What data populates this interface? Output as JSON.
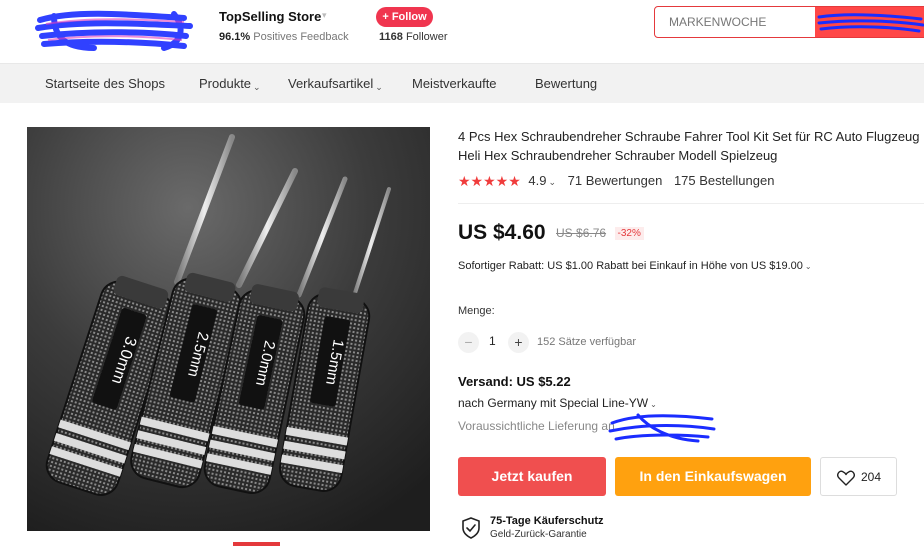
{
  "header": {
    "store_name": "TopSelling Store",
    "feedback_percent": "96.1%",
    "feedback_label": "Positives Feedback",
    "follow_label": "+ Follow",
    "follower_count": "1168",
    "follower_label": "Follower",
    "search_placeholder": "MARKENWOCHE"
  },
  "nav": {
    "items": [
      "Startseite des Shops",
      "Produkte",
      "Verkaufsartikel",
      "Meistverkaufte",
      "Bewertung"
    ]
  },
  "product": {
    "title": "4 Pcs Hex Schraubendreher Schraube Fahrer Tool Kit Set für RC Auto Flugzeug Heli Hex Schraubendreher Schrauber Modell Spielzeug",
    "stars": "★★★★★",
    "rating_value": "4.9",
    "rating_count": 4.9,
    "reviews": "71 Bewertungen",
    "orders": "175 Bestellungen",
    "price": "US $4.60",
    "old_price": "US $6.76",
    "discount": "-32%",
    "coupon": "Sofortiger Rabatt: US $1.00 Rabatt bei Einkauf in Höhe von US $19.00",
    "qty_label": "Menge:",
    "qty_value": "1",
    "stock": "152 Sätze verfügbar",
    "shipping": "Versand: US $5.22",
    "ship_to": "nach Germany mit Special Line-YW",
    "delivery": "Voraussichtliche Lieferung an",
    "buy_now": "Jetzt kaufen",
    "add_to_cart": "In den Einkaufswagen",
    "wishlist_count": "204",
    "protection_title": "75-Tage Käuferschutz",
    "protection_sub": "Geld-Zurück-Garantie",
    "tool_labels": [
      "3.0mm",
      "2.5mm",
      "2.0mm",
      "1.5mm"
    ]
  },
  "colors": {
    "accent_red": "#f04f4f",
    "cart_orange": "#ffa10f",
    "star_red": "#f03c3c",
    "redaction_blue": "#1a2cff"
  }
}
